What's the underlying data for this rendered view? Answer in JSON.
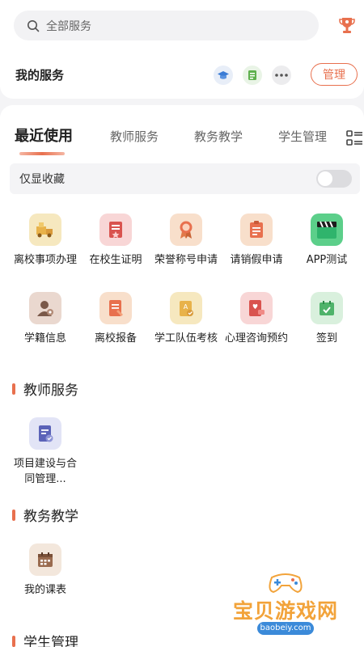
{
  "search": {
    "placeholder": "全部服务",
    "icon": "search-icon"
  },
  "header": {
    "trophy_icon": "trophy-icon",
    "accent": "#e8704e"
  },
  "my_services": {
    "title": "我的服务",
    "mini_icons": [
      "graduation-cap-icon",
      "id-card-icon",
      "more-dots-icon"
    ],
    "manage_label": "管理"
  },
  "tabs": [
    {
      "label": "最近使用",
      "active": true
    },
    {
      "label": "教师服务",
      "active": false
    },
    {
      "label": "教务教学",
      "active": false
    },
    {
      "label": "学生管理",
      "active": false
    }
  ],
  "favorites_only": {
    "label": "仅显收藏",
    "on": false
  },
  "recent_services": [
    {
      "label": "离校事项办理",
      "icon": "moving-truck-icon",
      "color": "#f6e8bf"
    },
    {
      "label": "在校生证明",
      "icon": "certificate-icon",
      "color": "#f8d6d6"
    },
    {
      "label": "荣誉称号申请",
      "icon": "medal-icon",
      "color": "#f8dfcb"
    },
    {
      "label": "请销假申请",
      "icon": "leave-form-icon",
      "color": "#f8dfcb"
    },
    {
      "label": "APP测试",
      "icon": "clapperboard-icon",
      "color": "#5ccf8a"
    },
    {
      "label": "学籍信息",
      "icon": "student-profile-icon",
      "color": "#ead8cf"
    },
    {
      "label": "离校报备",
      "icon": "report-form-icon",
      "color": "#f8dfcb"
    },
    {
      "label": "学工队伍考核",
      "icon": "assessment-icon",
      "color": "#f6e8bf"
    },
    {
      "label": "心理咨询预约",
      "icon": "counseling-icon",
      "color": "#f8d6d6"
    },
    {
      "label": "签到",
      "icon": "check-in-icon",
      "color": "#d9f0dd"
    }
  ],
  "sections": [
    {
      "title": "教师服务",
      "items": [
        {
          "label": "项目建设与合同管理...",
          "icon": "contract-icon",
          "color": "#e2e4f6"
        }
      ]
    },
    {
      "title": "教务教学",
      "items": [
        {
          "label": "我的课表",
          "icon": "calendar-icon",
          "color": "#f3e7dc"
        }
      ]
    },
    {
      "title": "学生管理",
      "items": []
    }
  ],
  "watermark": {
    "text": "宝贝游戏网",
    "url": "baobeiy.com"
  }
}
